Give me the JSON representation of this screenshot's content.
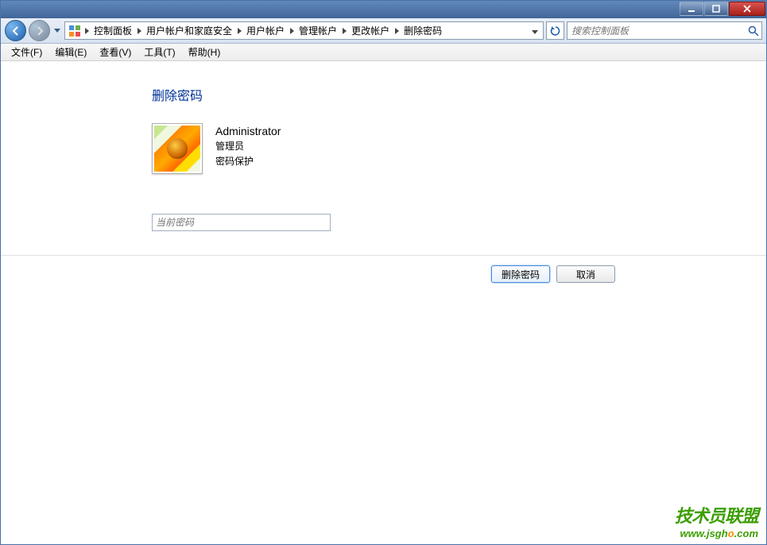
{
  "titlebar": {
    "minimize": "minimize",
    "maximize": "maximize",
    "close": "close"
  },
  "breadcrumb": [
    "控制面板",
    "用户帐户和家庭安全",
    "用户帐户",
    "管理帐户",
    "更改帐户",
    "删除密码"
  ],
  "search_placeholder": "搜索控制面板",
  "menus": [
    "文件(F)",
    "编辑(E)",
    "查看(V)",
    "工具(T)",
    "帮助(H)"
  ],
  "heading": "删除密码",
  "user": {
    "name": "Administrator",
    "role": "管理员",
    "protection": "密码保护"
  },
  "password_placeholder": "当前密码",
  "buttons": {
    "delete": "删除密码",
    "cancel": "取消"
  },
  "watermark": {
    "line1": "技术员联盟",
    "line2_a": "www.jsgh",
    "line2_b": ".com",
    "line2_o1": "o",
    "line2_o2": "o"
  }
}
